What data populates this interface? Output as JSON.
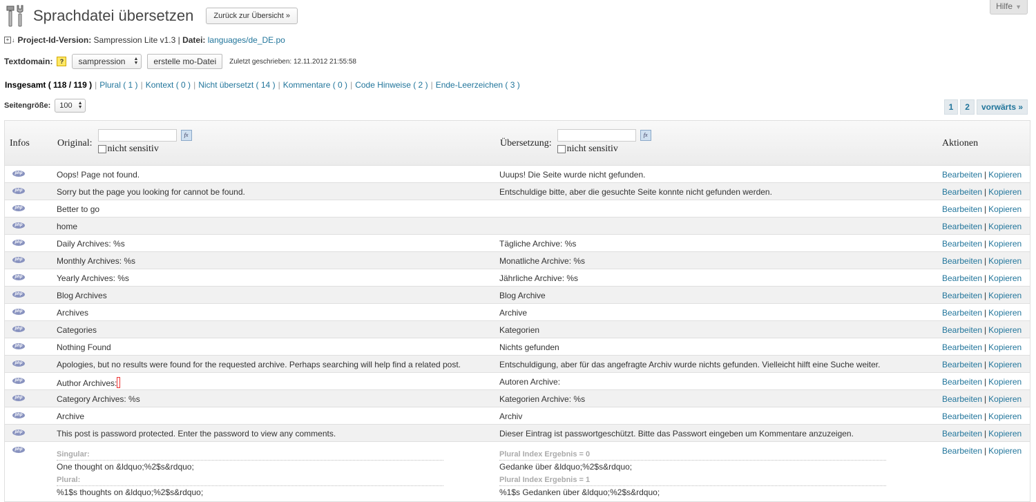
{
  "help": {
    "label": "Hilfe"
  },
  "header": {
    "title": "Sprachdatei übersetzen",
    "back_button": "Zurück zur Übersicht »"
  },
  "meta": {
    "project_label": "Project-Id-Version:",
    "project_value": "Sampression Lite v1.3",
    "sep": "|",
    "file_label": "Datei:",
    "file_value": "languages/de_DE.po"
  },
  "domain": {
    "label": "Textdomain:",
    "help_icon": "?",
    "selected": "sampression",
    "mo_button": "erstelle mo-Datei",
    "last_written": "Zuletzt geschrieben:  12.11.2012 21:55:58"
  },
  "filters": {
    "current": "Insgesamt ( 118 / 119 )",
    "items": [
      "Plural ( 1 )",
      "Kontext ( 0 )",
      "Nicht übersetzt ( 14 )",
      "Kommentare ( 0 )",
      "Code Hinweise ( 2 )",
      "Ende-Leerzeichen ( 3 )"
    ]
  },
  "pagesize": {
    "label": "Seitengröße:",
    "value": "100"
  },
  "pager": {
    "pages": [
      "1",
      "2"
    ],
    "next": "vorwärts »"
  },
  "table": {
    "headers": {
      "infos": "Infos",
      "original": "Original:",
      "translation": "Übersetzung:",
      "actions": "Aktionen",
      "not_sensitive": "nicht sensitiv",
      "fx": "fx"
    },
    "php_label": "php",
    "actions": {
      "edit": "Bearbeiten",
      "sep": "|",
      "copy": "Kopieren"
    },
    "rows": [
      {
        "original": "Oops! Page not found.",
        "translation": "Uuups! Die Seite wurde nicht gefunden."
      },
      {
        "original": "Sorry but the page you looking for cannot be found.",
        "translation": "Entschuldige bitte, aber die gesuchte Seite konnte nicht gefunden werden."
      },
      {
        "original": "Better to go",
        "translation": ""
      },
      {
        "original": "home",
        "translation": ""
      },
      {
        "original": "Daily Archives: %s",
        "translation": "Tägliche Archive: %s"
      },
      {
        "original": "Monthly Archives: %s",
        "translation": "Monatliche Archive: %s"
      },
      {
        "original": "Yearly Archives: %s",
        "translation": "Jährliche Archive: %s"
      },
      {
        "original": "Blog Archives",
        "translation": "Blog Archive"
      },
      {
        "original": "Archives",
        "translation": "Archive"
      },
      {
        "original": "Categories",
        "translation": "Kategorien"
      },
      {
        "original": "Nothing Found",
        "translation": "Nichts gefunden"
      },
      {
        "original": "Apologies, but no results were found for the requested archive. Perhaps searching will help find a related post.",
        "translation": "Entschuldigung, aber für das angefragte Archiv wurde nichts gefunden. Vielleicht hilft eine Suche weiter."
      },
      {
        "original": "Author Archives:",
        "translation": "Autoren Archive:",
        "trailing_space": true
      },
      {
        "original": "Category Archives: %s",
        "translation": "Kategorien Archive: %s"
      },
      {
        "original": "Archive",
        "translation": "Archiv"
      },
      {
        "original": "This post is password protected. Enter the password to view any comments.",
        "translation": "Dieser Eintrag ist passwortgeschützt. Bitte das Passwort eingeben um Kommentare anzuzeigen."
      }
    ],
    "plural_row": {
      "singular_label": "Singular:",
      "singular": "One thought on &ldquo;%2$s&rdquo;",
      "plural_label": "Plural:",
      "plural": "%1$s thoughts on &ldquo;%2$s&rdquo;",
      "idx0_label": "Plural Index Ergebnis = 0",
      "idx0": "Gedanke über &ldquo;%2$s&rdquo;",
      "idx1_label": "Plural Index Ergebnis = 1",
      "idx1": "%1$s Gedanken über &ldquo;%2$s&rdquo;"
    }
  }
}
